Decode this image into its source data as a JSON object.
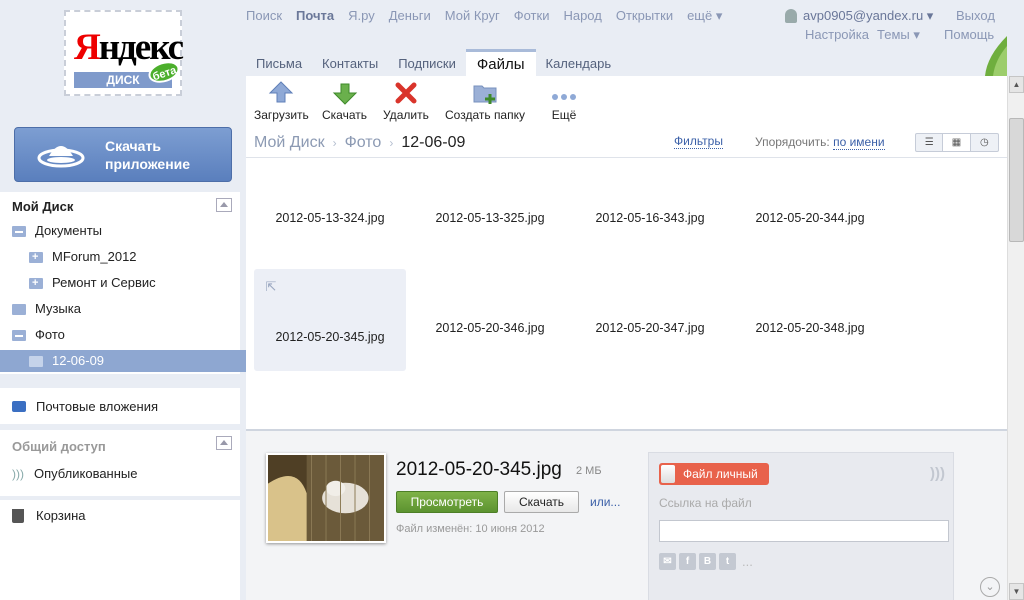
{
  "logo": {
    "brand": "Яндекс",
    "product": "ДИСК",
    "badge": "бета"
  },
  "download_app": {
    "label": "Скачать\nприложение"
  },
  "top_nav": {
    "links": [
      "Поиск",
      "Почта",
      "Я.ру",
      "Деньги",
      "Мой Круг",
      "Фотки",
      "Народ",
      "Открытки",
      "ещё ▾"
    ],
    "current": "Почта"
  },
  "user": {
    "email": "avp0905@yandex.ru ▾",
    "exit": "Выход",
    "settings": "Настройка",
    "themes": "Темы ▾",
    "help": "Помощь"
  },
  "tabs": [
    {
      "label": "Письма",
      "active": false
    },
    {
      "label": "Контакты",
      "active": false
    },
    {
      "label": "Подписки",
      "active": false
    },
    {
      "label": "Файлы",
      "active": true
    },
    {
      "label": "Календарь",
      "active": false
    }
  ],
  "sidebar": {
    "my_disk": "Мой Диск",
    "items": [
      {
        "label": "Документы",
        "level": 0,
        "icon": "folder-open-icon"
      },
      {
        "label": "MForum_2012",
        "level": 1,
        "icon": "folder-plus-icon"
      },
      {
        "label": "Ремонт и Сервис",
        "level": 1,
        "icon": "folder-plus-icon"
      },
      {
        "label": "Музыка",
        "level": 0,
        "icon": "folder-icon"
      },
      {
        "label": "Фото",
        "level": 0,
        "icon": "folder-open-icon"
      },
      {
        "label": "12-06-09",
        "level": 1,
        "icon": "folder-icon",
        "selected": true
      }
    ],
    "mail_attachments": "Почтовые вложения",
    "shared_title": "Общий доступ",
    "published": "Опубликованные",
    "trash": "Корзина"
  },
  "toolbar": {
    "upload": "Загрузить",
    "download": "Скачать",
    "delete": "Удалить",
    "new_folder": "Создать папку",
    "more": "Ещё"
  },
  "breadcrumb": {
    "root": "Мой Диск",
    "folder": "Фото",
    "current": "12-06-09"
  },
  "filters": "Фильтры",
  "sort": {
    "label": "Упорядочить:",
    "value": "по имени"
  },
  "files": [
    {
      "name": "2012-05-13-324.jpg",
      "orient": "portrait",
      "colors": [
        "#6f6e66",
        "#c9b7a6"
      ]
    },
    {
      "name": "2012-05-13-325.jpg",
      "orient": "portrait",
      "colors": [
        "#8b7a6a",
        "#d8cfc4"
      ]
    },
    {
      "name": "2012-05-16-343.jpg",
      "orient": "portrait",
      "colors": [
        "#5a4632",
        "#c59658"
      ]
    },
    {
      "name": "2012-05-20-344.jpg",
      "orient": "landscape",
      "colors": [
        "#4d7a3a",
        "#b8cfd8"
      ]
    },
    {
      "name": "2012-05-20-345.jpg",
      "orient": "landscape",
      "colors": [
        "#5a4a2a",
        "#d9d2c6"
      ],
      "selected": true
    },
    {
      "name": "2012-05-20-346.jpg",
      "orient": "landscape",
      "colors": [
        "#3f3a33",
        "#c8c2ba"
      ]
    },
    {
      "name": "2012-05-20-347.jpg",
      "orient": "landscape",
      "colors": [
        "#4c5e7a",
        "#9fa9b6"
      ]
    },
    {
      "name": "2012-05-20-348.jpg",
      "orient": "landscape",
      "colors": [
        "#4a5d6e",
        "#a7b4bd"
      ]
    },
    {
      "name": "",
      "orient": "portrait",
      "colors": [
        "#3a5f9a",
        "#caa88a"
      ]
    },
    {
      "name": "",
      "orient": "portrait",
      "colors": [
        "#2b2b2b",
        "#c9a584"
      ]
    },
    {
      "name": "",
      "orient": "doc",
      "colors": [
        "#333333",
        "#999999"
      ]
    },
    {
      "name": "",
      "orient": "landscape",
      "colors": [
        "#4e7a3c",
        "#aac6e0"
      ]
    }
  ],
  "detail": {
    "name": "2012-05-20-345.jpg",
    "size": "2 МБ",
    "view": "Просмотреть",
    "download": "Скачать",
    "or": "или...",
    "changed": "Файл изменён: 10 июня 2012",
    "toggle": "Файл личный",
    "link_label": "Ссылка на файл"
  },
  "socials": [
    "✉",
    "f",
    "В",
    "t"
  ],
  "socials_more": "..."
}
